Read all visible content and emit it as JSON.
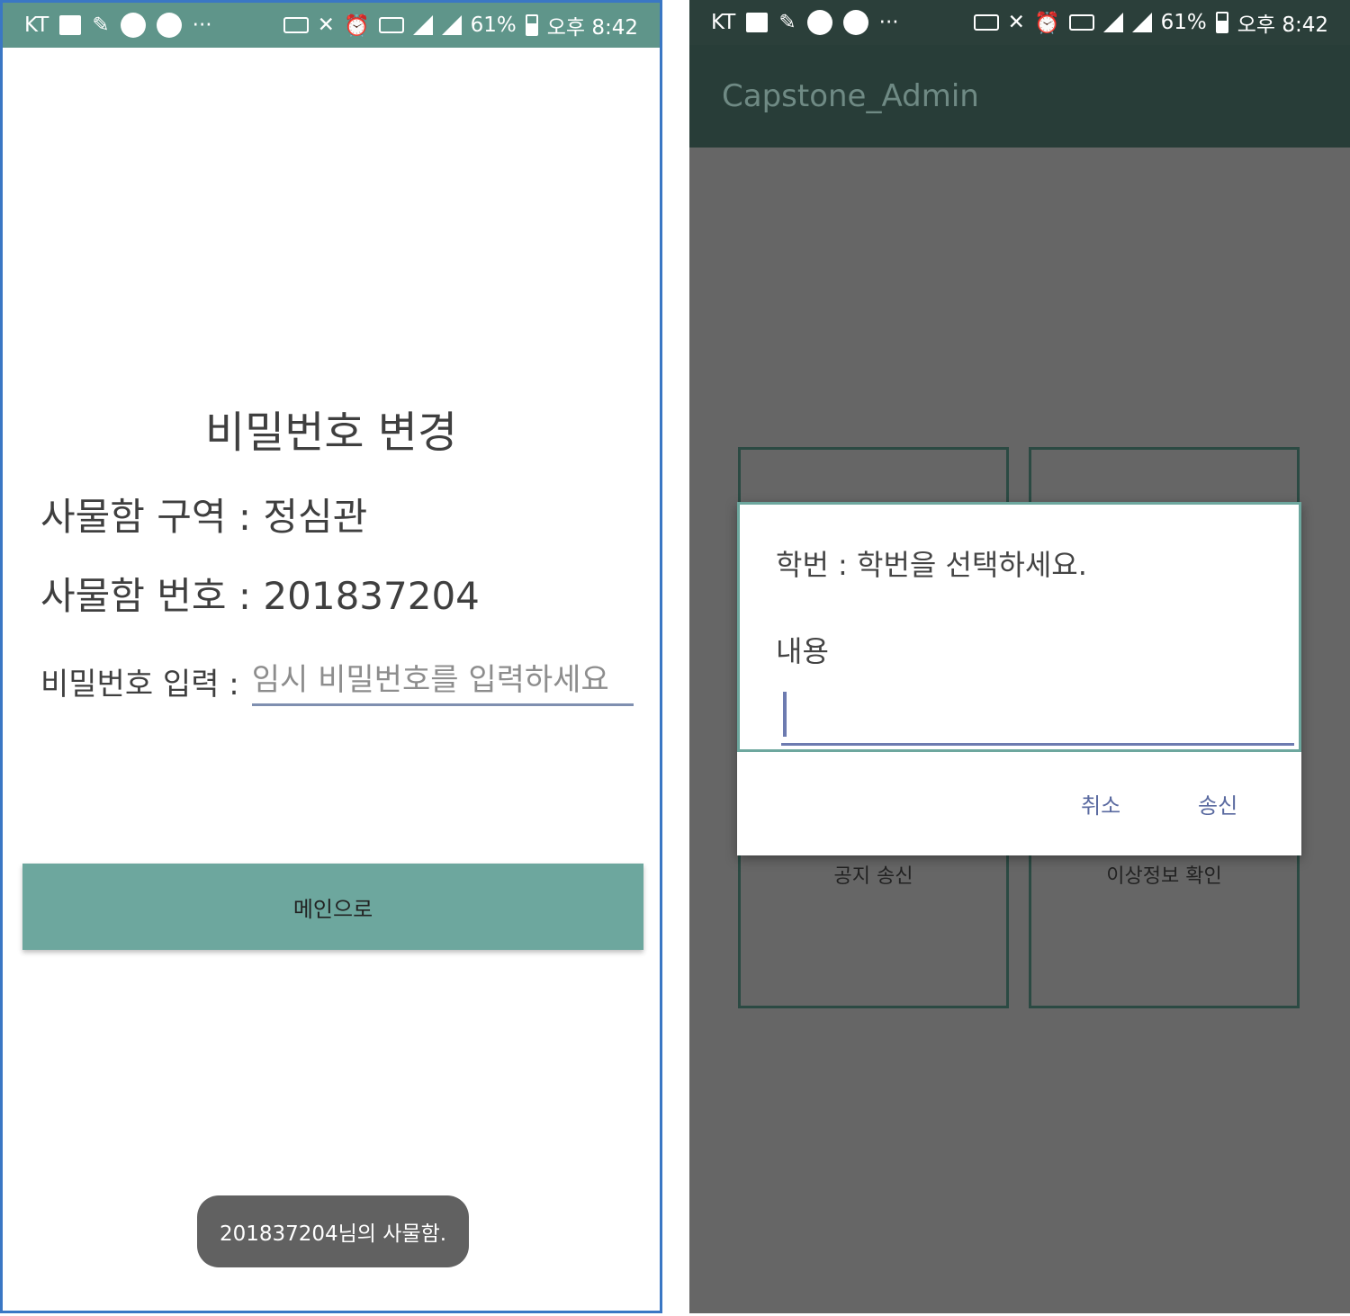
{
  "left_screen": {
    "status_bar": {
      "carrier": "KT",
      "more": "···",
      "battery": "61%",
      "time": "오후 8:42"
    },
    "title": "비밀번호 변경",
    "locker_area": "사물함 구역 : 정심관",
    "locker_number": "사물함 번호 : 201837204",
    "password": {
      "label": "비밀번호 입력 :",
      "placeholder": "임시 비밀번호를 입력하세요"
    },
    "main_button": "메인으로",
    "toast": "201837204님의 사물함."
  },
  "right_screen": {
    "status_bar": {
      "carrier": "KT",
      "more": "···",
      "battery": "61%",
      "time": "오후 8:42"
    },
    "app_title": "Capstone_Admin",
    "tiles": {
      "notice": "공지 송신",
      "anomaly": "이상정보 확인"
    },
    "dialog": {
      "student_id": "학번 : 학번을 선택하세요.",
      "content_label": "내용",
      "cancel": "취소",
      "send": "송신"
    }
  },
  "colors": {
    "left_status_bar": "#5f958a",
    "right_app_bar": "#283d38",
    "accent_teal": "#6da79e",
    "dim_overlay": "#666666",
    "input_underline": "#6d7bb0"
  }
}
